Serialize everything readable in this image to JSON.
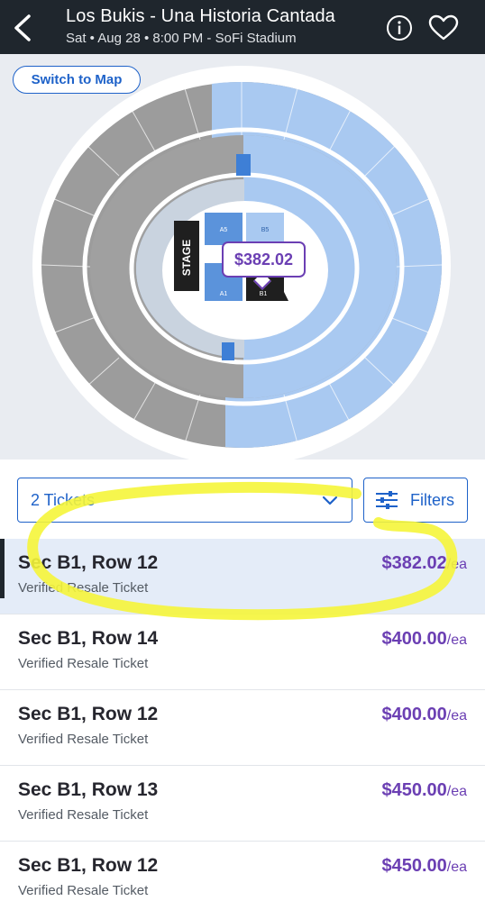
{
  "header": {
    "title": "Los Bukis - Una Historia Cantada",
    "subtitle": "Sat • Aug 28 • 8:00 PM - SoFi Stadium"
  },
  "map": {
    "switch_label": "Switch to Map",
    "stage_label": "STAGE",
    "price_pin": "$382.02",
    "floor_sections": [
      "A5",
      "B5",
      "A1",
      "B1"
    ]
  },
  "filters": {
    "quantity": "2 Tickets",
    "filters_label": "Filters"
  },
  "listings": [
    {
      "title": "Sec B1, Row 12",
      "subtitle": "Verified Resale Ticket",
      "price": "$382.02",
      "unit": "/ea"
    },
    {
      "title": "Sec B1, Row 14",
      "subtitle": "Verified Resale Ticket",
      "price": "$400.00",
      "unit": "/ea"
    },
    {
      "title": "Sec B1, Row 12",
      "subtitle": "Verified Resale Ticket",
      "price": "$400.00",
      "unit": "/ea"
    },
    {
      "title": "Sec B1, Row 13",
      "subtitle": "Verified Resale Ticket",
      "price": "$450.00",
      "unit": "/ea"
    },
    {
      "title": "Sec B1, Row 12",
      "subtitle": "Verified Resale Ticket",
      "price": "$450.00",
      "unit": "/ea"
    }
  ],
  "colors": {
    "header_bg": "#1f262d",
    "accent_blue": "#1e62c9",
    "price_purple": "#6b3fb3",
    "available_section": "#a9c9f1",
    "unavailable_section": "#9b9b9b",
    "highlight_yellow": "#f5f53a"
  }
}
